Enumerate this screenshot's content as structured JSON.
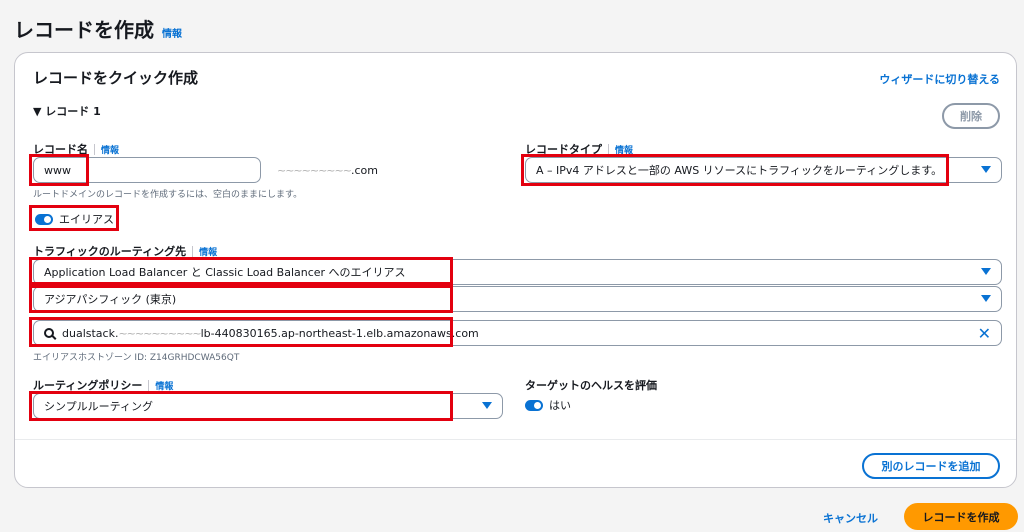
{
  "page": {
    "title": "レコードを作成",
    "info": "情報"
  },
  "card": {
    "title": "レコードをクイック作成",
    "wizard_link": "ウィザードに切り替える",
    "record_header": "▼ レコード 1",
    "delete_label": "削除"
  },
  "record_name": {
    "label": "レコード名",
    "info": "情報",
    "value": "www",
    "domain_suffix": ".com",
    "domain_masked": "~~~~~~~~~",
    "hint": "ルートドメインのレコードを作成するには、空白のままにします。"
  },
  "record_type": {
    "label": "レコードタイプ",
    "info": "情報",
    "value": "A – IPv4 アドレスと一部の AWS リソースにトラフィックをルーティングします。"
  },
  "alias": {
    "label": "エイリアス",
    "enabled": true
  },
  "traffic_route": {
    "label": "トラフィックのルーティング先",
    "info": "情報",
    "endpoint_type": "Application Load Balancer と Classic Load Balancer へのエイリアス",
    "region": "アジアパシフィック (東京)",
    "lb_prefix": "dualstack.",
    "lb_masked": "~~~~~~~~~~",
    "lb_suffix": "lb-440830165.ap-northeast-1.elb.amazonaws.com",
    "hosted_zone": "エイリアスホストゾーン ID: Z14GRHDCWA56QT"
  },
  "routing_policy": {
    "label": "ルーティングポリシー",
    "info": "情報",
    "value": "シンプルルーティング"
  },
  "health_check": {
    "label": "ターゲットのヘルスを評価",
    "value": "はい",
    "enabled": true
  },
  "actions": {
    "add_record": "別のレコードを追加",
    "cancel": "キャンセル",
    "create": "レコードを作成"
  },
  "colors": {
    "accent": "#0972d3",
    "primary_button": "#ff9900",
    "highlight": "#e3000f"
  }
}
